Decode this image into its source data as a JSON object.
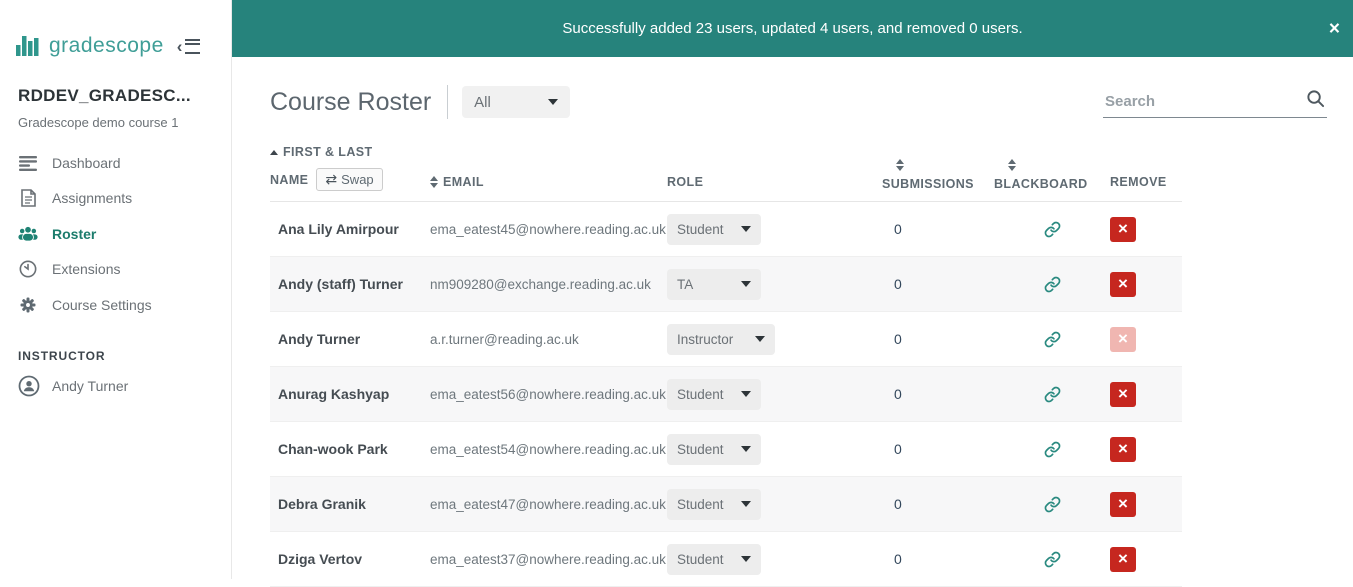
{
  "banner": {
    "message": "Successfully added 23 users, updated 4 users, and removed 0 users.",
    "close_glyph": "×"
  },
  "sidebar": {
    "logo_text": "gradescope",
    "collapse_chevron": "‹",
    "course_code": "RDDEV_GRADESC...",
    "course_name": "Gradescope demo course 1",
    "nav": {
      "dashboard": "Dashboard",
      "assignments": "Assignments",
      "roster": "Roster",
      "extensions": "Extensions",
      "course_settings": "Course Settings"
    },
    "section_label": "INSTRUCTOR",
    "instructor_name": "Andy Turner"
  },
  "main": {
    "title": "Course Roster",
    "filter_value": "All",
    "search_placeholder": "Search",
    "table": {
      "headers": {
        "name_line1": "FIRST & LAST",
        "name_line2": "NAME",
        "swap_label": "Swap",
        "email": "EMAIL",
        "role": "ROLE",
        "submissions": "SUBMISSIONS",
        "blackboard": "BLACKBOARD",
        "remove": "REMOVE"
      },
      "rows": [
        {
          "name": "Ana Lily Amirpour",
          "email": "ema_eatest45@nowhere.reading.ac.uk",
          "role": "Student",
          "submissions": "0",
          "remove_disabled": false
        },
        {
          "name": "Andy (staff) Turner",
          "email": "nm909280@exchange.reading.ac.uk",
          "role": "TA",
          "submissions": "0",
          "remove_disabled": false
        },
        {
          "name": "Andy Turner",
          "email": "a.r.turner@reading.ac.uk",
          "role": "Instructor",
          "submissions": "0",
          "remove_disabled": true
        },
        {
          "name": "Anurag Kashyap",
          "email": "ema_eatest56@nowhere.reading.ac.uk",
          "role": "Student",
          "submissions": "0",
          "remove_disabled": false
        },
        {
          "name": "Chan-wook Park",
          "email": "ema_eatest54@nowhere.reading.ac.uk",
          "role": "Student",
          "submissions": "0",
          "remove_disabled": false
        },
        {
          "name": "Debra Granik",
          "email": "ema_eatest47@nowhere.reading.ac.uk",
          "role": "Student",
          "submissions": "0",
          "remove_disabled": false
        },
        {
          "name": "Dziga Vertov",
          "email": "ema_eatest37@nowhere.reading.ac.uk",
          "role": "Student",
          "submissions": "0",
          "remove_disabled": false
        }
      ]
    }
  },
  "icons": {
    "swap": "⇄",
    "remove_x": "×",
    "logo": "bar-chart",
    "collapse": "chevron-hamburger",
    "search": "magnifier",
    "sort": "up-down-triangles",
    "sort_ascending": "up-triangle",
    "blackboard_link": "chain-link"
  },
  "colors": {
    "banner_teal": "#26837c",
    "brand_teal": "#3f9e97",
    "active_nav_teal": "#1c7c6c",
    "link_teal": "#2a8a80",
    "remove_red": "#c6271f",
    "remove_disabled_pink": "#f0b6b1"
  }
}
